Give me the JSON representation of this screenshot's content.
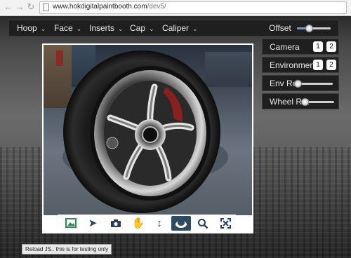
{
  "browser": {
    "url_host": "www.hokdigitalpaintbooth.com",
    "url_path": "/dev5/"
  },
  "menu": {
    "items": [
      {
        "label": "Hoop"
      },
      {
        "label": "Face"
      },
      {
        "label": "Inserts"
      },
      {
        "label": "Cap"
      },
      {
        "label": "Caliper"
      }
    ],
    "offset_label": "Offset",
    "offset_value": 0.35
  },
  "panels": {
    "camera": {
      "label": "Camera",
      "buttons": [
        "1",
        "2"
      ]
    },
    "environment": {
      "label": "Environment",
      "buttons": [
        "1",
        "2"
      ]
    },
    "env_rot": {
      "label": "Env Rot",
      "value": 0.0
    },
    "wheel_rot": {
      "label": "Wheel Rot",
      "value": 0.08
    }
  },
  "toolbar": {
    "tools": [
      {
        "icon": "image-icon"
      },
      {
        "icon": "pointer-icon"
      },
      {
        "icon": "camera-icon"
      },
      {
        "icon": "hand-pan-icon"
      },
      {
        "icon": "dolly-arrows-icon"
      },
      {
        "icon": "orbit-eye-icon",
        "active": true
      },
      {
        "icon": "zoom-magnifier-icon"
      },
      {
        "icon": "fullscreen-icon"
      }
    ]
  },
  "tooltip": {
    "text": "Reload JS.. this is for testing only"
  },
  "colors": {
    "panel_bg": "#1f1f1f",
    "accent": "#2f4a63",
    "slider_fill": "#5aa0d8"
  }
}
